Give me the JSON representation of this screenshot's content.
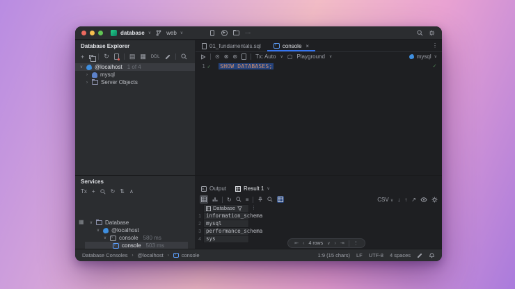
{
  "colors": {
    "accent": "#3574f0",
    "selection": "#25427a",
    "keyword_orange": "#cf8e6d",
    "ok_green": "#549159"
  },
  "titlebar": {
    "project": "database",
    "branch": "web"
  },
  "explorer": {
    "title": "Database Explorer",
    "ddl_label": "DDL",
    "tree": [
      {
        "label": "@localhost",
        "hint": "1 of 4"
      },
      {
        "label": "mysql"
      },
      {
        "label": "Server Objects"
      }
    ]
  },
  "editor": {
    "tabs": [
      {
        "label": "01_fundamentals.sql"
      },
      {
        "label": "console"
      }
    ],
    "toolbar": {
      "tx": "Tx: Auto",
      "playground": "Playground",
      "dialect": "mysql"
    },
    "line_number": "1",
    "code": "SHOW DATABASES;"
  },
  "services": {
    "title": "Services",
    "tx_label": "Tx",
    "tree": [
      {
        "label": "Database"
      },
      {
        "label": "@localhost"
      },
      {
        "label": "console",
        "time": "580 ms"
      },
      {
        "label": "console",
        "time": "503 ms"
      }
    ]
  },
  "results": {
    "tabs": [
      {
        "label": "Output"
      },
      {
        "label": "Result 1"
      }
    ],
    "toolbar": {
      "export_format": "CSV"
    },
    "table": {
      "header": "Database",
      "row_numbers": [
        "1",
        "2",
        "3",
        "4"
      ],
      "rows": [
        "information_schema",
        "mysql",
        "performance_schema",
        "sys"
      ]
    },
    "pagination": {
      "label": "4 rows"
    }
  },
  "statusbar": {
    "breadcrumb": [
      "Database Consoles",
      "@localhost",
      "console"
    ],
    "caret": "1:9 (15 chars)",
    "line_sep": "LF",
    "encoding": "UTF-8",
    "indent": "4 spaces"
  }
}
